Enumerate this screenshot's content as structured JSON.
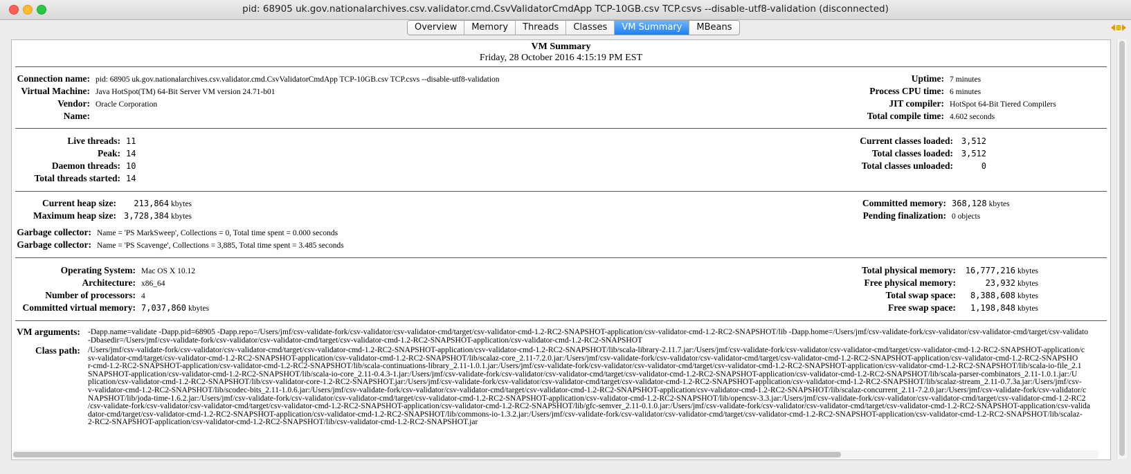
{
  "window": {
    "title": "pid: 68905 uk.gov.nationalarchives.csv.validator.cmd.CsvValidatorCmdApp TCP-10GB.csv TCP.csvs --disable-utf8-validation (disconnected)"
  },
  "tabs": [
    "Overview",
    "Memory",
    "Threads",
    "Classes",
    "VM Summary",
    "MBeans"
  ],
  "active_tab": "VM Summary",
  "header": {
    "title": "VM Summary",
    "datetime": "Friday, 28 October 2016 4:15:19 PM EST"
  },
  "connection": {
    "connection_name": {
      "label": "Connection name:",
      "value": "pid: 68905 uk.gov.nationalarchives.csv.validator.cmd.CsvValidatorCmdApp TCP-10GB.csv TCP.csvs --disable-utf8-validation"
    },
    "virtual_machine": {
      "label": "Virtual Machine:",
      "value": "Java HotSpot(TM) 64-Bit Server VM version 24.71-b01"
    },
    "vendor": {
      "label": "Vendor:",
      "value": "Oracle Corporation"
    },
    "name": {
      "label": "Name:",
      "value": ""
    },
    "uptime": {
      "label": "Uptime:",
      "value": "7 minutes"
    },
    "process_cpu_time": {
      "label": "Process CPU time:",
      "value": "6 minutes"
    },
    "jit_compiler": {
      "label": "JIT compiler:",
      "value": "HotSpot 64-Bit Tiered Compilers"
    },
    "total_compile_time": {
      "label": "Total compile time:",
      "value": "4.602 seconds"
    }
  },
  "threads": {
    "live": {
      "label": "Live threads:",
      "value": "11"
    },
    "peak": {
      "label": "Peak:",
      "value": "14"
    },
    "daemon": {
      "label": "Daemon threads:",
      "value": "10"
    },
    "total_started": {
      "label": "Total threads started:",
      "value": "14"
    }
  },
  "classes": {
    "current_loaded": {
      "label": "Current classes loaded:",
      "value": "3,512"
    },
    "total_loaded": {
      "label": "Total classes loaded:",
      "value": "3,512"
    },
    "total_unloaded": {
      "label": "Total classes unloaded:",
      "value": "0"
    }
  },
  "memory": {
    "current_heap": {
      "label": "Current heap size:",
      "value": "213,864",
      "unit": "kbytes"
    },
    "max_heap": {
      "label": "Maximum heap size:",
      "value": "3,728,384",
      "unit": "kbytes"
    },
    "committed": {
      "label": "Committed memory:",
      "value": "368,128",
      "unit": "kbytes"
    },
    "pending_finalization": {
      "label": "Pending finalization:",
      "value": "0 objects"
    },
    "gc1": {
      "label": "Garbage collector:",
      "value": "Name = 'PS MarkSweep', Collections = 0, Total time spent = 0.000 seconds"
    },
    "gc2": {
      "label": "Garbage collector:",
      "value": "Name = 'PS Scavenge', Collections = 3,885, Total time spent = 3.485 seconds"
    }
  },
  "os": {
    "operating_system": {
      "label": "Operating System:",
      "value": "Mac OS X 10.12"
    },
    "architecture": {
      "label": "Architecture:",
      "value": "x86_64"
    },
    "processors": {
      "label": "Number of processors:",
      "value": "4"
    },
    "committed_virtual": {
      "label": "Committed virtual memory:",
      "value": "7,037,860",
      "unit": "kbytes"
    },
    "total_physical": {
      "label": "Total physical memory:",
      "value": "16,777,216",
      "unit": "kbytes"
    },
    "free_physical": {
      "label": "Free physical memory:",
      "value": "23,932",
      "unit": "kbytes"
    },
    "total_swap": {
      "label": "Total swap space:",
      "value": "8,388,608",
      "unit": "kbytes"
    },
    "free_swap": {
      "label": "Free swap space:",
      "value": "1,198,848",
      "unit": "kbytes"
    }
  },
  "vm_arguments": {
    "label": "VM arguments:",
    "text": "-Dapp.name=validate -Dapp.pid=68905 -Dapp.repo=/Users/jmf/csv-validate-fork/csv-validator/csv-validator-cmd/target/csv-validator-cmd-1.2-RC2-SNAPSHOT-application/csv-validator-cmd-1.2-RC2-SNAPSHOT/lib -Dapp.home=/Users/jmf/csv-validate-fork/csv-validator/csv-validator-cmd/target/csv-validato\n-Dbasedir=/Users/jmf/csv-validate-fork/csv-validator/csv-validator-cmd/target/csv-validator-cmd-1.2-RC2-SNAPSHOT-application/csv-validator-cmd-1.2-RC2-SNAPSHOT"
  },
  "class_path": {
    "label": "Class path:",
    "text": "/Users/jmf/csv-validate-fork/csv-validator/csv-validator-cmd/target/csv-validator-cmd-1.2-RC2-SNAPSHOT-application/csv-validator-cmd-1.2-RC2-SNAPSHOT/lib/scala-library-2.11.7.jar:/Users/jmf/csv-validate-fork/csv-validator/csv-validator-cmd/target/csv-validator-cmd-1.2-RC2-SNAPSHOT-application/c\nsv-validator-cmd/target/csv-validator-cmd-1.2-RC2-SNAPSHOT-application/csv-validator-cmd-1.2-RC2-SNAPSHOT/lib/scalaz-core_2.11-7.2.0.jar:/Users/jmf/csv-validate-fork/csv-validator/csv-validator-cmd/target/csv-validator-cmd-1.2-RC2-SNAPSHOT-application/csv-validator-cmd-1.2-RC2-SNAPSHO\nr-cmd-1.2-RC2-SNAPSHOT-application/csv-validator-cmd-1.2-RC2-SNAPSHOT/lib/scala-continuations-library_2.11-1.0.1.jar:/Users/jmf/csv-validate-fork/csv-validator/csv-validator-cmd/target/csv-validator-cmd-1.2-RC2-SNAPSHOT-application/csv-validator-cmd-1.2-RC2-SNAPSHOT/lib/scala-io-file_2.1\nSNAPSHOT-application/csv-validator-cmd-1.2-RC2-SNAPSHOT/lib/scala-io-core_2.11-0.4.3-1.jar:/Users/jmf/csv-validate-fork/csv-validator/csv-validator-cmd/target/csv-validator-cmd-1.2-RC2-SNAPSHOT-application/csv-validator-cmd-1.2-RC2-SNAPSHOT/lib/scala-parser-combinators_2.11-1.0.1.jar:/U\nplication/csv-validator-cmd-1.2-RC2-SNAPSHOT/lib/csv-validator-core-1.2-RC2-SNAPSHOT.jar:/Users/jmf/csv-validate-fork/csv-validator/csv-validator-cmd/target/csv-validator-cmd-1.2-RC2-SNAPSHOT-application/csv-validator-cmd-1.2-RC2-SNAPSHOT/lib/scalaz-stream_2.11-0.7.3a.jar:/Users/jmf/csv-\nv-validator-cmd-1.2-RC2-SNAPSHOT/lib/scodec-bits_2.11-1.0.6.jar:/Users/jmf/csv-validate-fork/csv-validator/csv-validator-cmd/target/csv-validator-cmd-1.2-RC2-SNAPSHOT-application/csv-validator-cmd-1.2-RC2-SNAPSHOT/lib/scalaz-concurrent_2.11-7.2.0.jar:/Users/jmf/csv-validate-fork/csv-validator/c\nNAPSHOT/lib/joda-time-1.6.2.jar:/Users/jmf/csv-validate-fork/csv-validator/csv-validator-cmd/target/csv-validator-cmd-1.2-RC2-SNAPSHOT-application/csv-validator-cmd-1.2-RC2-SNAPSHOT/lib/opencsv-3.3.jar:/Users/jmf/csv-validate-fork/csv-validator/csv-validator-cmd/target/csv-validator-cmd-1.2-RC2\n/csv-validate-fork/csv-validator/csv-validator-cmd/target/csv-validator-cmd-1.2-RC2-SNAPSHOT-application/csv-validator-cmd-1.2-RC2-SNAPSHOT/lib/gfc-semver_2.11-0.1.0.jar:/Users/jmf/csv-validate-fork/csv-validator/csv-validator-cmd/target/csv-validator-cmd-1.2-RC2-SNAPSHOT-application/csv-valida\ndator-cmd/target/csv-validator-cmd-1.2-RC2-SNAPSHOT-application/csv-validator-cmd-1.2-RC2-SNAPSHOT/lib/commons-io-1.3.2.jar:/Users/jmf/csv-validate-fork/csv-validator/csv-validator-cmd/target/csv-validator-cmd-1.2-RC2-SNAPSHOT-application/csv-validator-cmd-1.2-RC2-SNAPSHOT/lib/scalaz-\n2-RC2-SNAPSHOT-application/csv-validator-cmd-1.2-RC2-SNAPSHOT/lib/csv-validator-cmd-1.2-RC2-SNAPSHOT.jar"
  }
}
